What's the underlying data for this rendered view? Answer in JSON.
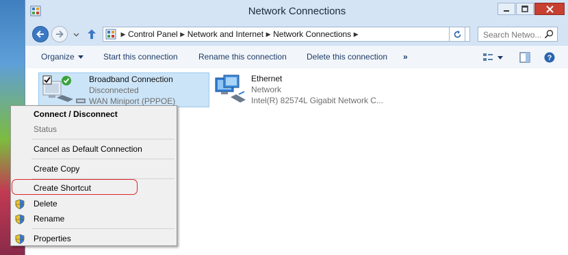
{
  "window": {
    "title": "Network Connections"
  },
  "breadcrumbs": [
    "Control Panel",
    "Network and Internet",
    "Network Connections"
  ],
  "search": {
    "placeholder": "Search Netwo..."
  },
  "toolbar": {
    "organize": "Organize",
    "start": "Start this connection",
    "rename": "Rename this connection",
    "delete": "Delete this connection",
    "more": "»"
  },
  "connections": [
    {
      "name": "Broadband Connection",
      "status": "Disconnected",
      "device": "WAN Miniport (PPPOE)"
    },
    {
      "name": "Ethernet",
      "status": "Network",
      "device": "Intel(R) 82574L Gigabit Network C..."
    }
  ],
  "context_menu": {
    "items": [
      "Connect / Disconnect",
      "Status",
      "Cancel as Default Connection",
      "Create Copy",
      "Create Shortcut",
      "Delete",
      "Rename",
      "Properties"
    ]
  },
  "colors": {
    "accent": "#3b79c4",
    "selection": "#cce4f7",
    "highlight_ring": "#d9252b",
    "close_button": "#c74031"
  }
}
